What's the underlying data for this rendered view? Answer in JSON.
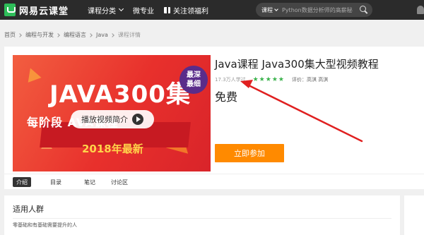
{
  "nav": {
    "logo_text": "网易云课堂",
    "items": [
      {
        "label": "课程分类"
      },
      {
        "label": "微专业"
      },
      {
        "label": "关注领福利"
      }
    ],
    "search": {
      "category": "课程",
      "placeholder": "Python数据分析师的高薪秘"
    }
  },
  "breadcrumb": [
    "首页",
    "编程与开发",
    "编程语言",
    "Java",
    "课程详情"
  ],
  "banner": {
    "headline": "JAVA300集",
    "badge_line1": "最深",
    "badge_line2": "最细",
    "subline": "每阶段                   AVA课程",
    "year_text": "2018年最新",
    "play_label": "播放视频简介"
  },
  "course": {
    "title": "Java课程 Java300集大型视频教程",
    "learners": "17.3万人学过",
    "stars": 5,
    "rating_text": "评价：高淇 高淇",
    "price": "免费",
    "join_label": "立即参加"
  },
  "tabs": [
    {
      "label": "介绍",
      "active": true
    },
    {
      "label": "目录",
      "active": false
    },
    {
      "label": "笔记",
      "active": false
    },
    {
      "label": "讨论区",
      "active": false
    }
  ],
  "audience": {
    "title": "适用人群",
    "text": "零基础和有基础需要提升的人"
  },
  "colors": {
    "nav_bg": "#2b2b2b",
    "logo_green": "#2ebd59",
    "join_orange": "#ff8a00",
    "star_green": "#3ab24c",
    "annotation_red": "#e02020"
  }
}
